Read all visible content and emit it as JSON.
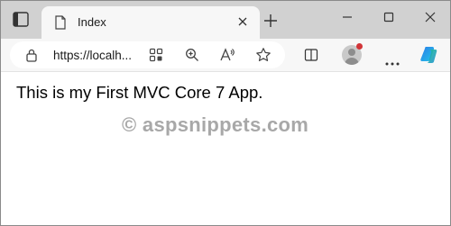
{
  "tab": {
    "title": "Index"
  },
  "address_bar": {
    "url": "https://localh..."
  },
  "content": {
    "heading": "This is my First MVC Core 7 App.",
    "watermark": "© aspsnippets.com"
  },
  "icons": {
    "tab_actions": "tab-actions-icon",
    "page": "page-icon",
    "close": "close-icon",
    "new_tab": "plus-icon",
    "minimize": "minimize-icon",
    "maximize": "maximize-icon",
    "window_close": "close-icon",
    "lock": "lock-icon",
    "apps": "app-available-icon",
    "zoom": "zoom-icon",
    "read_aloud": "read-aloud-icon",
    "favorite": "star-icon",
    "split_screen": "split-screen-icon",
    "profile": "avatar",
    "more": "more-icon",
    "copilot": "copilot-icon"
  },
  "colors": {
    "tab_strip": "#d1d1d1",
    "toolbar": "#f7f7f7",
    "notification": "#d13438",
    "watermark": "#a8a8a8"
  }
}
